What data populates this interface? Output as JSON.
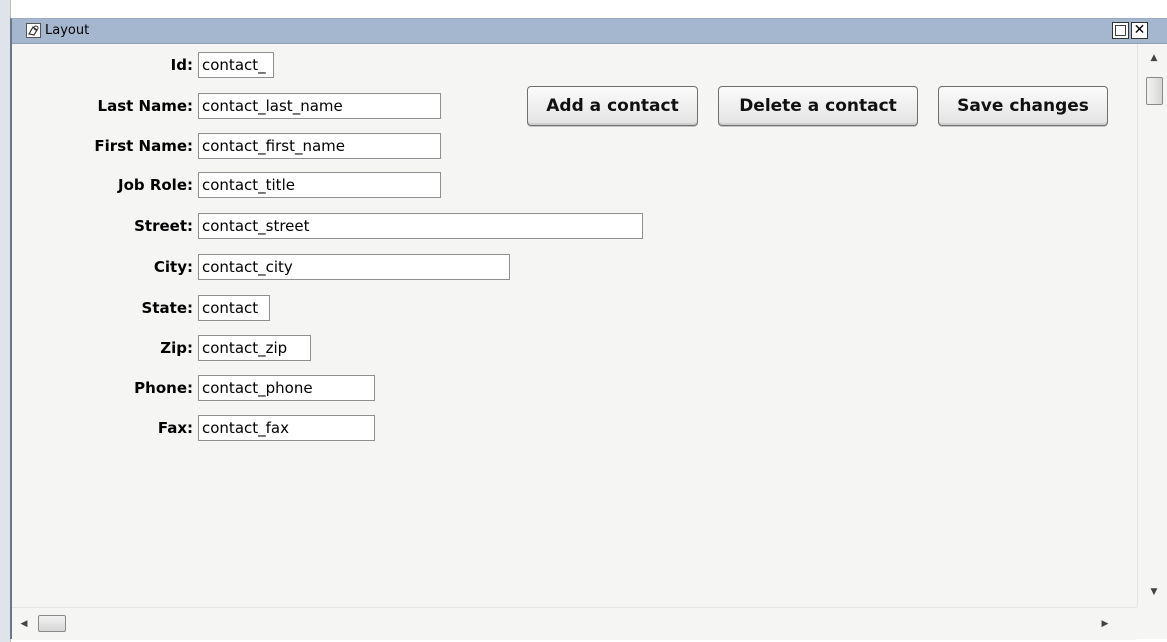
{
  "window": {
    "title": "Layout",
    "restore_glyph": "□",
    "close_glyph": "✕"
  },
  "form": {
    "fields": [
      {
        "label": "Id:",
        "value": "contact_"
      },
      {
        "label": "Last Name:",
        "value": "contact_last_name"
      },
      {
        "label": "First Name:",
        "value": "contact_first_name"
      },
      {
        "label": "Job Role:",
        "value": "contact_title"
      },
      {
        "label": "Street:",
        "value": "contact_street"
      },
      {
        "label": "City:",
        "value": "contact_city"
      },
      {
        "label": "State:",
        "value": "contact"
      },
      {
        "label": "Zip:",
        "value": "contact_zip"
      },
      {
        "label": "Phone:",
        "value": "contact_phone"
      },
      {
        "label": "Fax:",
        "value": "contact_fax"
      }
    ]
  },
  "toolbar": {
    "add_label": "Add a contact",
    "delete_label": "Delete a contact",
    "save_label": "Save changes"
  },
  "scrollbars": {
    "up_glyph": "▲",
    "down_glyph": "▼",
    "left_glyph": "◀",
    "right_glyph": "▶"
  },
  "colors": {
    "titlebar": "#a4b7cf",
    "background": "#f5f5f3"
  }
}
